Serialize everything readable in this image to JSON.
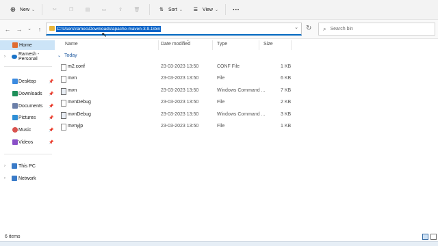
{
  "toolbar": {
    "new_label": "New",
    "sort_label": "Sort",
    "view_label": "View",
    "more_label": "···"
  },
  "address": {
    "path": "C:\\Users\\rames\\Downloads\\apache-maven-3.9.1\\bin",
    "search_placeholder": "Search bin"
  },
  "sidebar": {
    "items": [
      {
        "label": "Home",
        "icon": "home-icon",
        "color": "#e06b2f",
        "selected": true
      },
      {
        "label": "Ramesh - Personal",
        "icon": "onedrive-icon",
        "color": "#1a73c8",
        "caret": true
      },
      {
        "label": "Desktop",
        "icon": "desktop-icon",
        "color": "#3b8be0",
        "pinned": true
      },
      {
        "label": "Downloads",
        "icon": "downloads-icon",
        "color": "#1e8f5a",
        "pinned": true
      },
      {
        "label": "Documents",
        "icon": "documents-icon",
        "color": "#6b7fa8",
        "pinned": true
      },
      {
        "label": "Pictures",
        "icon": "pictures-icon",
        "color": "#2f8fd6",
        "pinned": true
      },
      {
        "label": "Music",
        "icon": "music-icon",
        "color": "#d9534f",
        "pinned": true
      },
      {
        "label": "Videos",
        "icon": "videos-icon",
        "color": "#8a4fc7",
        "pinned": true
      },
      {
        "label": "This PC",
        "icon": "this-pc-icon",
        "color": "#3a7bc8",
        "caret": true
      },
      {
        "label": "Network",
        "icon": "network-icon",
        "color": "#3a7bc8",
        "caret": true
      }
    ]
  },
  "columns": {
    "name": "Name",
    "date": "Date modified",
    "type": "Type",
    "size": "Size"
  },
  "group_label": "Today",
  "files": [
    {
      "name": "m2.conf",
      "date": "23-03-2023 13:50",
      "type": "CONF File",
      "size": "1 KB",
      "cmd": false
    },
    {
      "name": "mvn",
      "date": "23-03-2023 13:50",
      "type": "File",
      "size": "6 KB",
      "cmd": false
    },
    {
      "name": "mvn",
      "date": "23-03-2023 13:50",
      "type": "Windows Command ...",
      "size": "7 KB",
      "cmd": true
    },
    {
      "name": "mvnDebug",
      "date": "23-03-2023 13:50",
      "type": "File",
      "size": "2 KB",
      "cmd": false
    },
    {
      "name": "mvnDebug",
      "date": "23-03-2023 13:50",
      "type": "Windows Command ...",
      "size": "3 KB",
      "cmd": true
    },
    {
      "name": "mvnyjp",
      "date": "23-03-2023 13:50",
      "type": "File",
      "size": "1 KB",
      "cmd": false
    }
  ],
  "status": {
    "item_count": "6 items"
  }
}
